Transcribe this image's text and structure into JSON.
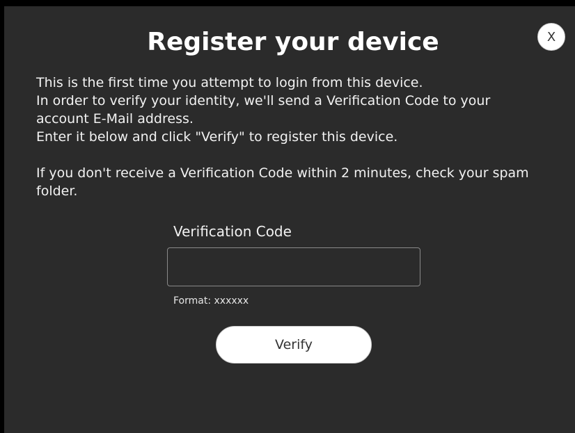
{
  "dialog": {
    "title": "Register your device",
    "close_label": "X",
    "paragraphs": [
      "This is the first time you attempt to login from this device.\nIn order to verify your identity, we'll send a Verification Code to your account E-Mail address.\nEnter it below and click \"Verify\" to register this device.",
      "If you don't receive a Verification Code within 2 minutes, check your spam folder."
    ],
    "code_label": "Verification Code",
    "code_value": "",
    "format_hint": "Format: xxxxxx",
    "verify_label": "Verify"
  },
  "colors": {
    "dialog_background": "#2b2b2b",
    "page_background": "#000000",
    "text": "#ffffff",
    "button_background": "#ffffff"
  }
}
